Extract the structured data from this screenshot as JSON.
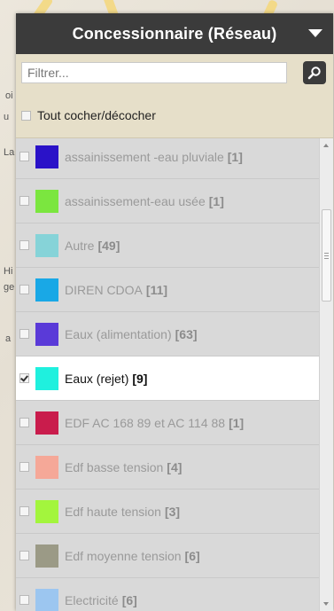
{
  "panel": {
    "title": "Concessionnaire (Réseau)"
  },
  "filter": {
    "placeholder": "Filtrer..."
  },
  "toggle_all": {
    "label": "Tout cocher/décocher",
    "checked": false
  },
  "items": [
    {
      "label": "assainissement -eau pluviale",
      "count": "[1]",
      "color": "#2a12c8",
      "checked": false
    },
    {
      "label": "assainissement-eau usée",
      "count": "[1]",
      "color": "#7be63f",
      "checked": false
    },
    {
      "label": "Autre",
      "count": "[49]",
      "color": "#86d3d8",
      "checked": false
    },
    {
      "label": "DIREN CDOA",
      "count": "[11]",
      "color": "#19a8e6",
      "checked": false
    },
    {
      "label": "Eaux (alimentation)",
      "count": "[63]",
      "color": "#5a3ad8",
      "checked": false
    },
    {
      "label": "Eaux (rejet)",
      "count": "[9]",
      "color": "#1ff0de",
      "checked": true
    },
    {
      "label": "EDF AC 168 89 et AC 114 88",
      "count": "[1]",
      "color": "#c91c4c",
      "checked": false
    },
    {
      "label": "Edf basse tension",
      "count": "[4]",
      "color": "#f5a898",
      "checked": false
    },
    {
      "label": "Edf haute tension",
      "count": "[3]",
      "color": "#a3f53d",
      "checked": false
    },
    {
      "label": "Edf moyenne tension",
      "count": "[6]",
      "color": "#9b9a86",
      "checked": false
    },
    {
      "label": "Electricité",
      "count": "[6]",
      "color": "#9cc6f0",
      "checked": false
    }
  ],
  "map_labels": [
    "oi",
    "u",
    "La",
    "Hi",
    "ge",
    "a"
  ]
}
